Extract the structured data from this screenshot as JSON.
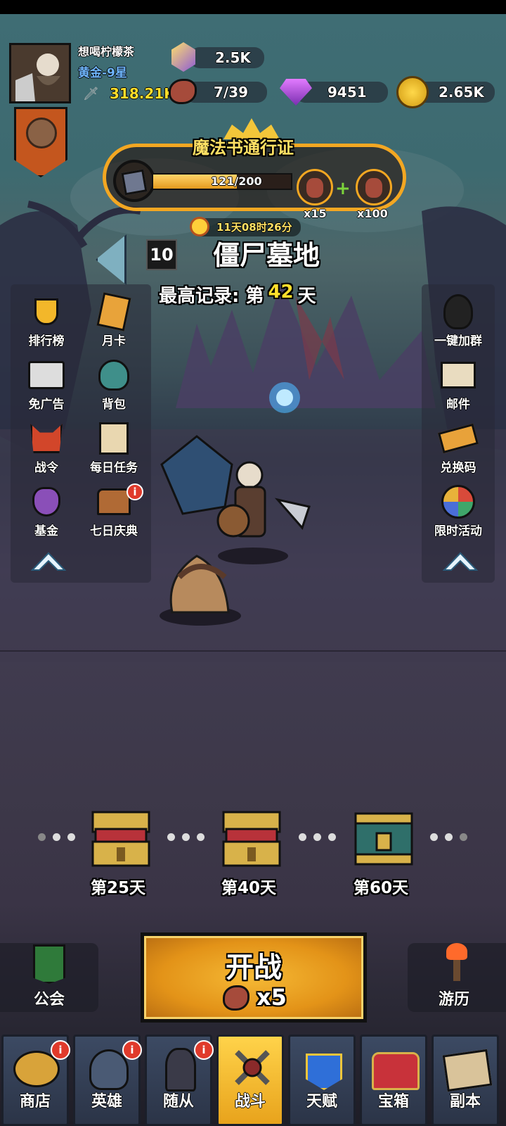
{
  "player": {
    "name": "想喝柠檬茶",
    "rank": "黄金-9星",
    "power": "318.21K"
  },
  "resources": {
    "crystal": "2.5K",
    "meat": "7/39",
    "gems": "9451",
    "gold": "2.65K"
  },
  "pass": {
    "title": "魔法书通行证",
    "progress_text": "121/200",
    "progress": 0.605,
    "reward1_qty": "x15",
    "reward2_qty": "x100",
    "timer": "11天08时26分"
  },
  "stage": {
    "number": "10",
    "name": "僵尸墓地",
    "record_prefix": "最高记录: 第",
    "record_day": "42",
    "record_suffix": "天"
  },
  "left_menu": [
    "排行榜",
    "月卡",
    "免广告",
    "背包",
    "战令",
    "每日任务",
    "基金",
    "七日庆典"
  ],
  "right_menu": [
    "一键加群",
    "邮件",
    "兑换码",
    "限时活动"
  ],
  "badge_text": "i",
  "milestones": [
    "第25天",
    "第40天",
    "第60天"
  ],
  "guild_label": "公会",
  "travel_label": "游历",
  "battle": {
    "label": "开战",
    "cost": "x5"
  },
  "nav": [
    "商店",
    "英雄",
    "随从",
    "战斗",
    "天赋",
    "宝箱",
    "副本"
  ],
  "colors": {
    "gold_text": "#ffdf2b",
    "rank_blue": "#6fb6ff",
    "battle_orange": "#e8a01a",
    "active_tab": "#ffc93a"
  }
}
